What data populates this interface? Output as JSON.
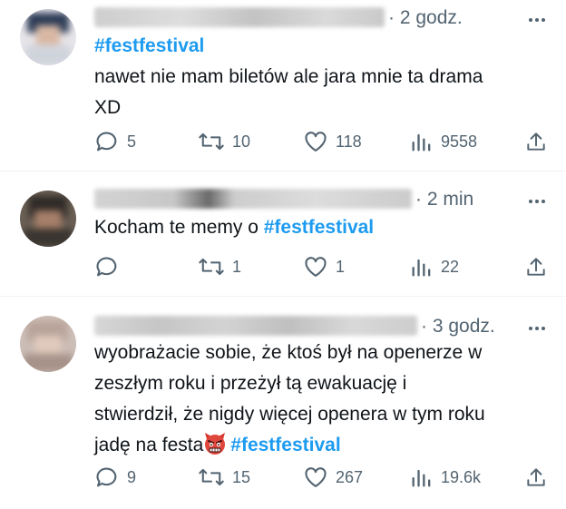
{
  "tweets": [
    {
      "time": "· 2 godz.",
      "text_lines": [
        "nawet nie mam biletów ale jara mnie ta drama",
        "XD"
      ],
      "hashtag": "#festfestival",
      "hashtag_position": "first_line",
      "replies": "5",
      "reposts": "10",
      "likes": "118",
      "views": "9558"
    },
    {
      "time": "· 2 min",
      "text_prefix": "Kocham te memy o ",
      "hashtag": "#festfestival",
      "replies": "",
      "reposts": "1",
      "likes": "1",
      "views": "22"
    },
    {
      "time": "· 3 godz.",
      "text_lines": [
        "wyobrażacie sobie, że ktoś był na openerze w",
        "zeszłym roku i przeżył tą ewakuację i",
        "stwierdził, że nigdy więcej openera w tym roku"
      ],
      "last_line_prefix": "jadę na festa",
      "emoji": "angry-devil-emoji",
      "hashtag": "#festfestival",
      "replies": "9",
      "reposts": "15",
      "likes": "267",
      "views": "19.6k"
    }
  ],
  "colors": {
    "accent": "#1d9bf0",
    "secondary_text": "#536471",
    "divider": "#eff3f4"
  },
  "icons": [
    "reply-icon",
    "repost-icon",
    "like-icon",
    "views-icon",
    "share-icon",
    "more-icon"
  ]
}
